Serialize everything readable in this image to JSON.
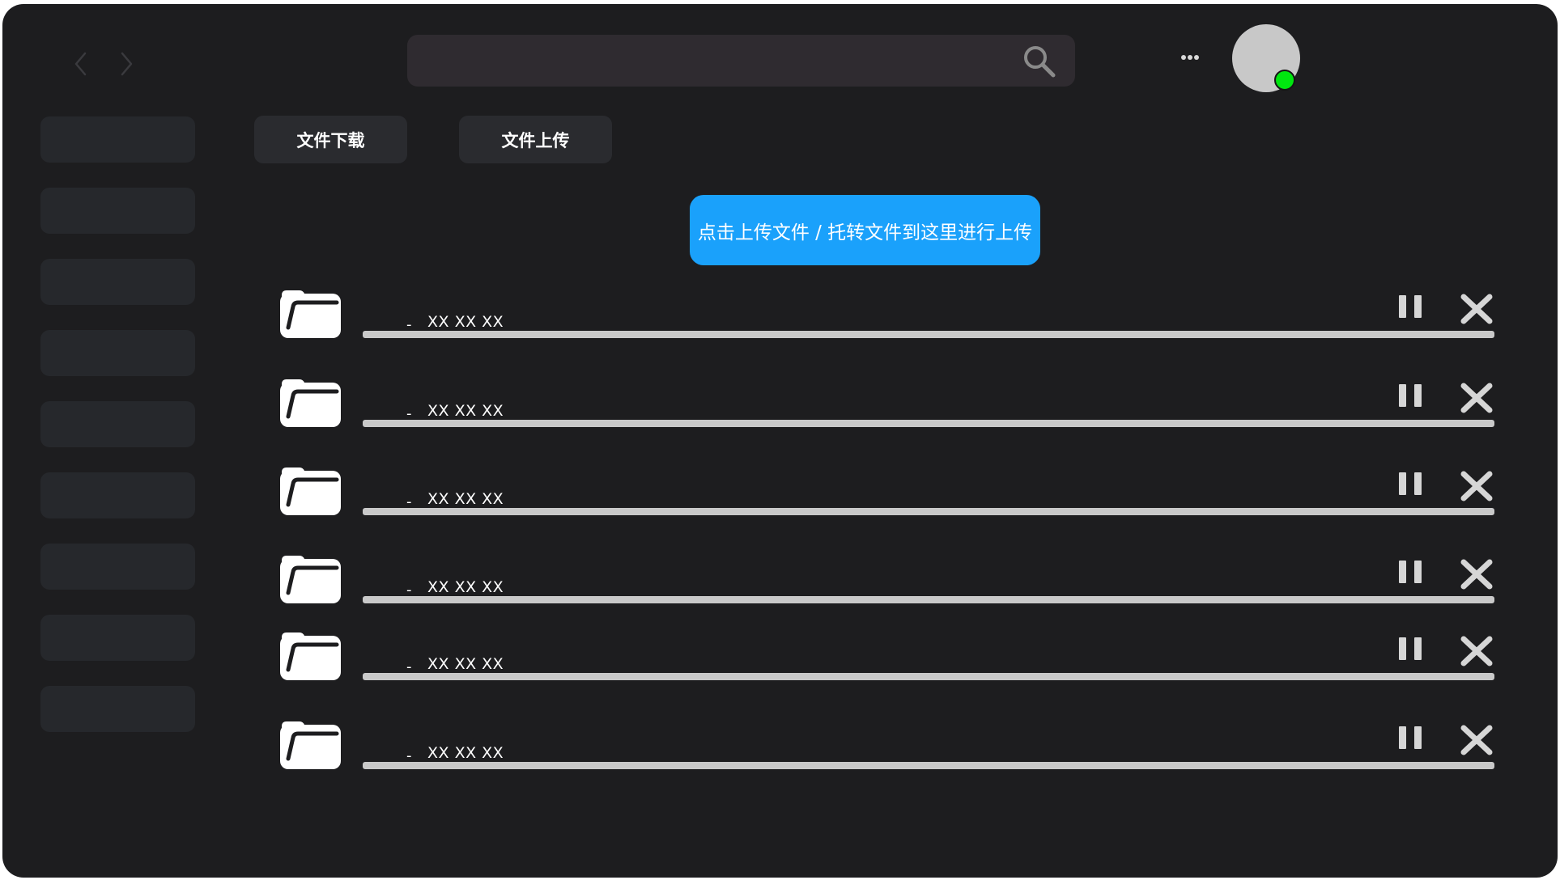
{
  "search": {
    "placeholder": ""
  },
  "tabs": {
    "download_label": "文件下载",
    "upload_label": "文件上传"
  },
  "upload_button": {
    "label": "点击上传文件 / 托转文件到这里进行上传"
  },
  "colors": {
    "window_bg": "#1d1d1f",
    "accent": "#1aa1fb",
    "online": "#00e60f",
    "progress": "#c9c9c9"
  },
  "icons": {
    "back": "chevron-left-icon",
    "forward": "chevron-right-icon",
    "search": "search-icon",
    "more": "more-icon",
    "folder": "folder-icon",
    "pause": "pause-icon",
    "close": "close-icon"
  },
  "files": [
    {
      "dash": "-",
      "name": "XX XX XX",
      "progress": 1.0
    },
    {
      "dash": "-",
      "name": "XX XX XX",
      "progress": 1.0
    },
    {
      "dash": "-",
      "name": "XX XX XX",
      "progress": 1.0
    },
    {
      "dash": "-",
      "name": "XX XX XX",
      "progress": 1.0
    },
    {
      "dash": "-",
      "name": "XX XX XX",
      "progress": 1.0
    },
    {
      "dash": "-",
      "name": "XX XX XX",
      "progress": 1.0
    }
  ]
}
